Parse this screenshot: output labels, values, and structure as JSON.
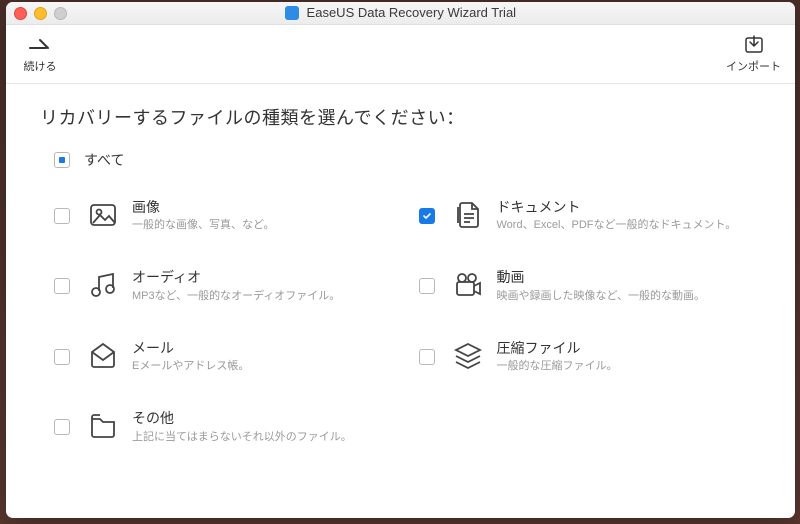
{
  "app_title": "EaseUS Data Recovery Wizard Trial",
  "toolbar": {
    "continue_label": "続ける",
    "import_label": "インポート"
  },
  "heading": "リカバリーするファイルの種類を選んでください：",
  "select_all": {
    "label": "すべて",
    "state": "partial"
  },
  "categories": [
    {
      "key": "images",
      "title": "画像",
      "desc": "一般的な画像、写真、など。",
      "checked": false
    },
    {
      "key": "document",
      "title": "ドキュメント",
      "desc": "Word、Excel、PDFなど一般的なドキュメント。",
      "checked": true
    },
    {
      "key": "audio",
      "title": "オーディオ",
      "desc": "MP3など、一般的なオーディオファイル。",
      "checked": false
    },
    {
      "key": "video",
      "title": "動画",
      "desc": "映画や録画した映像など、一般的な動画。",
      "checked": false
    },
    {
      "key": "mail",
      "title": "メール",
      "desc": "Eメールやアドレス帳。",
      "checked": false
    },
    {
      "key": "archive",
      "title": "圧縮ファイル",
      "desc": "一般的な圧縮ファイル。",
      "checked": false
    },
    {
      "key": "other",
      "title": "その他",
      "desc": "上記に当てはまらないそれ以外のファイル。",
      "checked": false
    }
  ]
}
